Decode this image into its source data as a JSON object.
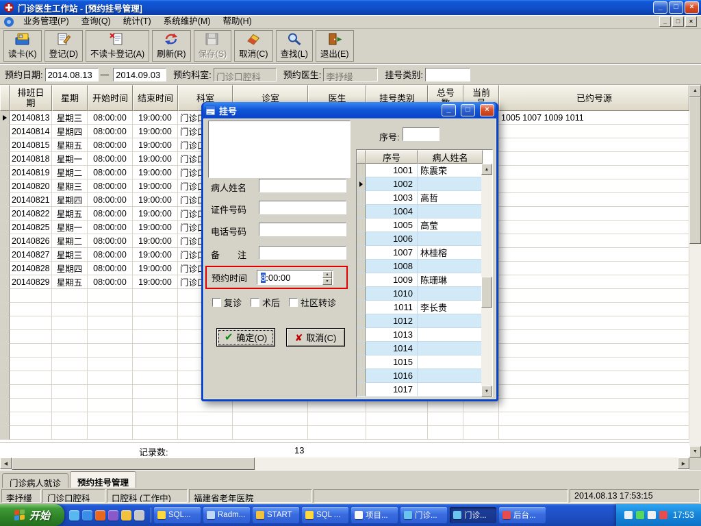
{
  "window": {
    "title": "门诊医生工作站 - [预约挂号管理]"
  },
  "menubar": {
    "items": [
      "业务管理(P)",
      "查询(Q)",
      "统计(T)",
      "系统维护(M)",
      "帮助(H)"
    ]
  },
  "toolbar": {
    "buttons": [
      {
        "label": "读卡(K)",
        "icon": "card-reader",
        "enabled": true
      },
      {
        "label": "登记(D)",
        "icon": "register",
        "enabled": true
      },
      {
        "label": "不读卡登记(A)",
        "icon": "register-nocard",
        "enabled": true
      },
      {
        "label": "刷新(R)",
        "icon": "refresh",
        "enabled": true
      },
      {
        "label": "保存(S)",
        "icon": "save",
        "enabled": false
      },
      {
        "label": "取消(C)",
        "icon": "cancel",
        "enabled": true
      },
      {
        "label": "查找(L)",
        "icon": "find",
        "enabled": true
      },
      {
        "label": "退出(E)",
        "icon": "exit",
        "enabled": true
      }
    ]
  },
  "filterbar": {
    "date_label": "预约日期:",
    "date_from": "2014.08.13",
    "date_separator": "—",
    "date_to": "2014.09.03",
    "dept_label": "预约科室:",
    "dept_value": "门诊口腔科",
    "doctor_label": "预约医生:",
    "doctor_value": "李抒缦",
    "type_label": "挂号类别:",
    "type_value": ""
  },
  "schedule": {
    "columns": [
      "排班日期",
      "星期",
      "开始时间",
      "结束时间",
      "科室",
      "诊室",
      "医生",
      "挂号类别",
      "总号数",
      "当前号",
      "已约号源"
    ],
    "rows": [
      {
        "date": "20140813",
        "weekday": "星期三",
        "start": "08:00:00",
        "end": "19:00:00",
        "dept": "门诊口腔科",
        "room": "",
        "doctor": "",
        "type": "",
        "total": "",
        "current": "",
        "booked": "1005 1007 1009 1011"
      },
      {
        "date": "20140814",
        "weekday": "星期四",
        "start": "08:00:00",
        "end": "19:00:00",
        "dept": "门诊口腔科",
        "room": "",
        "doctor": "",
        "type": "",
        "total": "",
        "current": "",
        "booked": ""
      },
      {
        "date": "20140815",
        "weekday": "星期五",
        "start": "08:00:00",
        "end": "19:00:00",
        "dept": "门诊口腔科",
        "room": "",
        "doctor": "",
        "type": "",
        "total": "",
        "current": "",
        "booked": ""
      },
      {
        "date": "20140818",
        "weekday": "星期一",
        "start": "08:00:00",
        "end": "19:00:00",
        "dept": "门诊口腔科",
        "room": "",
        "doctor": "",
        "type": "",
        "total": "",
        "current": "",
        "booked": ""
      },
      {
        "date": "20140819",
        "weekday": "星期二",
        "start": "08:00:00",
        "end": "19:00:00",
        "dept": "门诊口腔科",
        "room": "",
        "doctor": "",
        "type": "",
        "total": "",
        "current": "",
        "booked": ""
      },
      {
        "date": "20140820",
        "weekday": "星期三",
        "start": "08:00:00",
        "end": "19:00:00",
        "dept": "门诊口腔科",
        "room": "",
        "doctor": "",
        "type": "",
        "total": "",
        "current": "",
        "booked": ""
      },
      {
        "date": "20140821",
        "weekday": "星期四",
        "start": "08:00:00",
        "end": "19:00:00",
        "dept": "门诊口腔科",
        "room": "",
        "doctor": "",
        "type": "",
        "total": "",
        "current": "",
        "booked": ""
      },
      {
        "date": "20140822",
        "weekday": "星期五",
        "start": "08:00:00",
        "end": "19:00:00",
        "dept": "门诊口腔科",
        "room": "",
        "doctor": "",
        "type": "",
        "total": "",
        "current": "",
        "booked": ""
      },
      {
        "date": "20140825",
        "weekday": "星期一",
        "start": "08:00:00",
        "end": "19:00:00",
        "dept": "门诊口腔科",
        "room": "",
        "doctor": "",
        "type": "",
        "total": "",
        "current": "",
        "booked": ""
      },
      {
        "date": "20140826",
        "weekday": "星期二",
        "start": "08:00:00",
        "end": "19:00:00",
        "dept": "门诊口腔科",
        "room": "",
        "doctor": "",
        "type": "",
        "total": "",
        "current": "",
        "booked": ""
      },
      {
        "date": "20140827",
        "weekday": "星期三",
        "start": "08:00:00",
        "end": "19:00:00",
        "dept": "门诊口腔科",
        "room": "",
        "doctor": "",
        "type": "",
        "total": "",
        "current": "",
        "booked": ""
      },
      {
        "date": "20140828",
        "weekday": "星期四",
        "start": "08:00:00",
        "end": "19:00:00",
        "dept": "门诊口腔科",
        "room": "",
        "doctor": "",
        "type": "",
        "total": "",
        "current": "",
        "booked": ""
      },
      {
        "date": "20140829",
        "weekday": "星期五",
        "start": "08:00:00",
        "end": "19:00:00",
        "dept": "门诊口腔科",
        "room": "",
        "doctor": "",
        "type": "",
        "total": "",
        "current": "",
        "booked": ""
      }
    ],
    "record_count_label": "记录数:",
    "record_count": "13"
  },
  "dialog": {
    "title": "挂号",
    "serial_label": "序号:",
    "serial_value": "",
    "fields": [
      {
        "label": "病人姓名",
        "value": ""
      },
      {
        "label": "证件号码",
        "value": ""
      },
      {
        "label": "电话号码",
        "value": ""
      },
      {
        "label": "备　　注",
        "value": ""
      }
    ],
    "time": {
      "label": "预约时间",
      "selected_part": "8",
      "rest_part": ":00:00"
    },
    "checkboxes": [
      "复诊",
      "术后",
      "社区转诊"
    ],
    "ok_label": "确定(O)",
    "cancel_label": "取消(C)",
    "grid": {
      "columns": [
        "序号",
        "病人姓名"
      ],
      "selected_index": 1,
      "rows": [
        {
          "no": "1001",
          "name": "陈震荣"
        },
        {
          "no": "1002",
          "name": ""
        },
        {
          "no": "1003",
          "name": "高哲"
        },
        {
          "no": "1004",
          "name": ""
        },
        {
          "no": "1005",
          "name": "高莹"
        },
        {
          "no": "1006",
          "name": ""
        },
        {
          "no": "1007",
          "name": "林桂榕"
        },
        {
          "no": "1008",
          "name": ""
        },
        {
          "no": "1009",
          "name": "陈珊琳"
        },
        {
          "no": "1010",
          "name": ""
        },
        {
          "no": "1011",
          "name": "李长贵"
        },
        {
          "no": "1012",
          "name": ""
        },
        {
          "no": "1013",
          "name": ""
        },
        {
          "no": "1014",
          "name": ""
        },
        {
          "no": "1015",
          "name": ""
        },
        {
          "no": "1016",
          "name": ""
        },
        {
          "no": "1017",
          "name": ""
        }
      ]
    }
  },
  "tabs": [
    {
      "label": "门诊病人就诊",
      "active": false
    },
    {
      "label": "预约挂号管理",
      "active": true
    }
  ],
  "statusbar": {
    "segments": [
      "李抒缦",
      "门诊口腔科",
      "口腔科 (工作中)",
      "福建省老年医院",
      "",
      "2014.08.13 17:53:15"
    ]
  },
  "taskbar": {
    "start_label": "开始",
    "quick_launch": [
      {
        "name": "ie-icon",
        "color": "#58b8f0"
      },
      {
        "name": "desktop-icon",
        "color": "#3a8ee8"
      },
      {
        "name": "media-player-icon",
        "color": "#e86820"
      },
      {
        "name": "app-icon",
        "color": "#8a58c8"
      },
      {
        "name": "folder-icon",
        "color": "#f2c23e"
      },
      {
        "name": "mail-icon",
        "color": "#c8c8c8"
      }
    ],
    "tasks": [
      {
        "label": "SQL...",
        "icon_color": "#ffd83e",
        "active": false
      },
      {
        "label": "Radm...",
        "icon_color": "#c0d8f8",
        "active": false
      },
      {
        "label": "START",
        "icon_color": "#f2c23e",
        "active": false
      },
      {
        "label": "SQL ...",
        "icon_color": "#ffd83e",
        "active": false
      },
      {
        "label": "项目...",
        "icon_color": "#f8f8f8",
        "active": false
      },
      {
        "label": "门诊...",
        "icon_color": "#6ac4ee",
        "active": false
      },
      {
        "label": "门诊...",
        "icon_color": "#6ac4ee",
        "active": true
      },
      {
        "label": "后台...",
        "icon_color": "#e84c4c",
        "active": false
      }
    ],
    "tray": {
      "icons": [
        {
          "name": "language-icon",
          "color": "#e8f0f8"
        },
        {
          "name": "network-icon",
          "color": "#58d858"
        },
        {
          "name": "volume-icon",
          "color": "#f0f0f0"
        },
        {
          "name": "antivirus-icon",
          "color": "#e84c4c"
        }
      ],
      "time": "17:53"
    }
  }
}
